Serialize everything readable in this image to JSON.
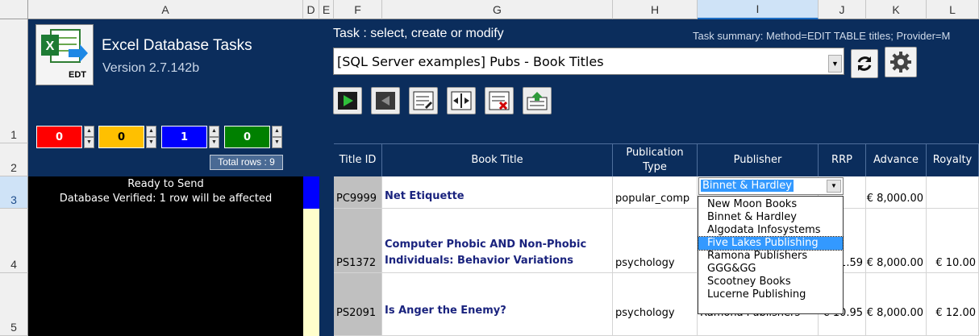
{
  "columns": [
    "A",
    "D",
    "E",
    "F",
    "G",
    "H",
    "I",
    "J",
    "K",
    "L"
  ],
  "rows": [
    "1",
    "2",
    "3",
    "4",
    "5"
  ],
  "app": {
    "title": "Excel Database Tasks",
    "version": "Version 2.7.142b",
    "logo_label": "EDT"
  },
  "task": {
    "heading": "Task : select, create or modify",
    "summary": "Task summary: Method=EDIT TABLE titles; Provider=M",
    "selected": "[SQL Server examples] Pubs - Book Titles"
  },
  "counters": [
    {
      "value": "0",
      "color": "#ff0000",
      "text_color": "#ffffff"
    },
    {
      "value": "0",
      "color": "#ffc000",
      "text_color": "#000000"
    },
    {
      "value": "1",
      "color": "#0000ff",
      "text_color": "#ffffff"
    },
    {
      "value": "0",
      "color": "#008000",
      "text_color": "#ffffff"
    }
  ],
  "total_rows": "Total rows : 9",
  "status": {
    "line1": "Ready to Send",
    "line2": "Database Verified: 1 row will be affected"
  },
  "toolbar_icons": [
    "run-icon",
    "back-icon",
    "edit-icon",
    "resize-icon",
    "delete-icon",
    "export-icon"
  ],
  "table": {
    "headers": {
      "title_id": "Title ID",
      "book_title": "Book Title",
      "pub_type": "Publication Type",
      "publisher": "Publisher",
      "rrp": "RRP",
      "advance": "Advance",
      "royalty": "Royalty"
    },
    "rows": [
      {
        "title_id": "PC9999",
        "book_title": "Net Etiquette",
        "pub_type": "popular_comp",
        "publisher": "Binnet & Hardley",
        "rrp": "",
        "advance": "€ 8,000.00",
        "royalty": ""
      },
      {
        "title_id": "PS1372",
        "book_title": "Computer Phobic AND Non-Phobic Individuals: Behavior Variations",
        "pub_type": "psychology",
        "publisher": "",
        "rrp": "1.59",
        "advance": "€ 8,000.00",
        "royalty": "€ 10.00"
      },
      {
        "title_id": "PS2091",
        "book_title": "Is Anger the Enemy?",
        "pub_type": "psychology",
        "publisher": "Ramona Publishers",
        "rrp": "€ 10.95",
        "advance": "€ 8,000.00",
        "royalty": "€ 12.00"
      }
    ]
  },
  "publisher_dropdown": {
    "value": "Binnet & Hardley",
    "options": [
      "New Moon Books",
      "Binnet & Hardley",
      "Algodata Infosystems",
      "Five Lakes Publishing",
      "Ramona Publishers",
      "GGG&GG",
      "Scootney Books",
      "Lucerne Publishing"
    ],
    "highlighted": "Five Lakes Publishing"
  }
}
